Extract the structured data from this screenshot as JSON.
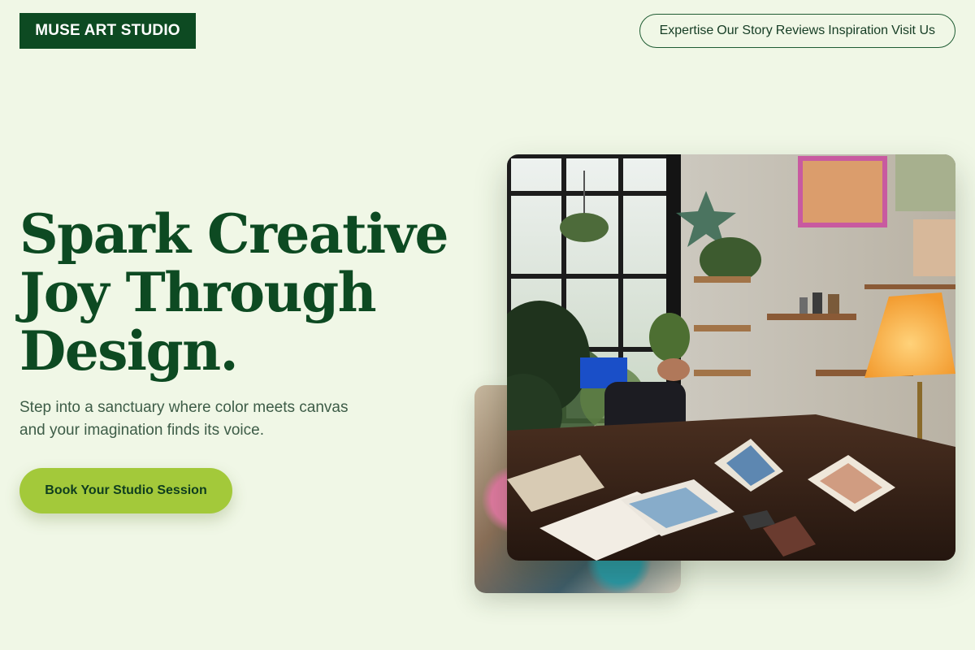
{
  "header": {
    "logo": "MUSE ART STUDIO",
    "nav": [
      {
        "label": "Expertise"
      },
      {
        "label": "Our Story"
      },
      {
        "label": "Reviews"
      },
      {
        "label": "Inspiration"
      },
      {
        "label": "Visit Us"
      }
    ]
  },
  "hero": {
    "headline_line1": "Spark Creative",
    "headline_line2": "Joy Through",
    "headline_line3": "Design.",
    "subtext": "Step into a sanctuary where color meets canvas and your imagination finds its voice.",
    "cta_label": "Book Your Studio Session"
  },
  "images": {
    "main_alt": "Art studio interior with plants, lamp and sketchbooks on a desk",
    "secondary_alt": "Close-up of a paint palette with colorful paints"
  },
  "colors": {
    "background": "#f0f7e6",
    "brand_green": "#0d4a22",
    "accent_lime": "#a3c93a"
  }
}
